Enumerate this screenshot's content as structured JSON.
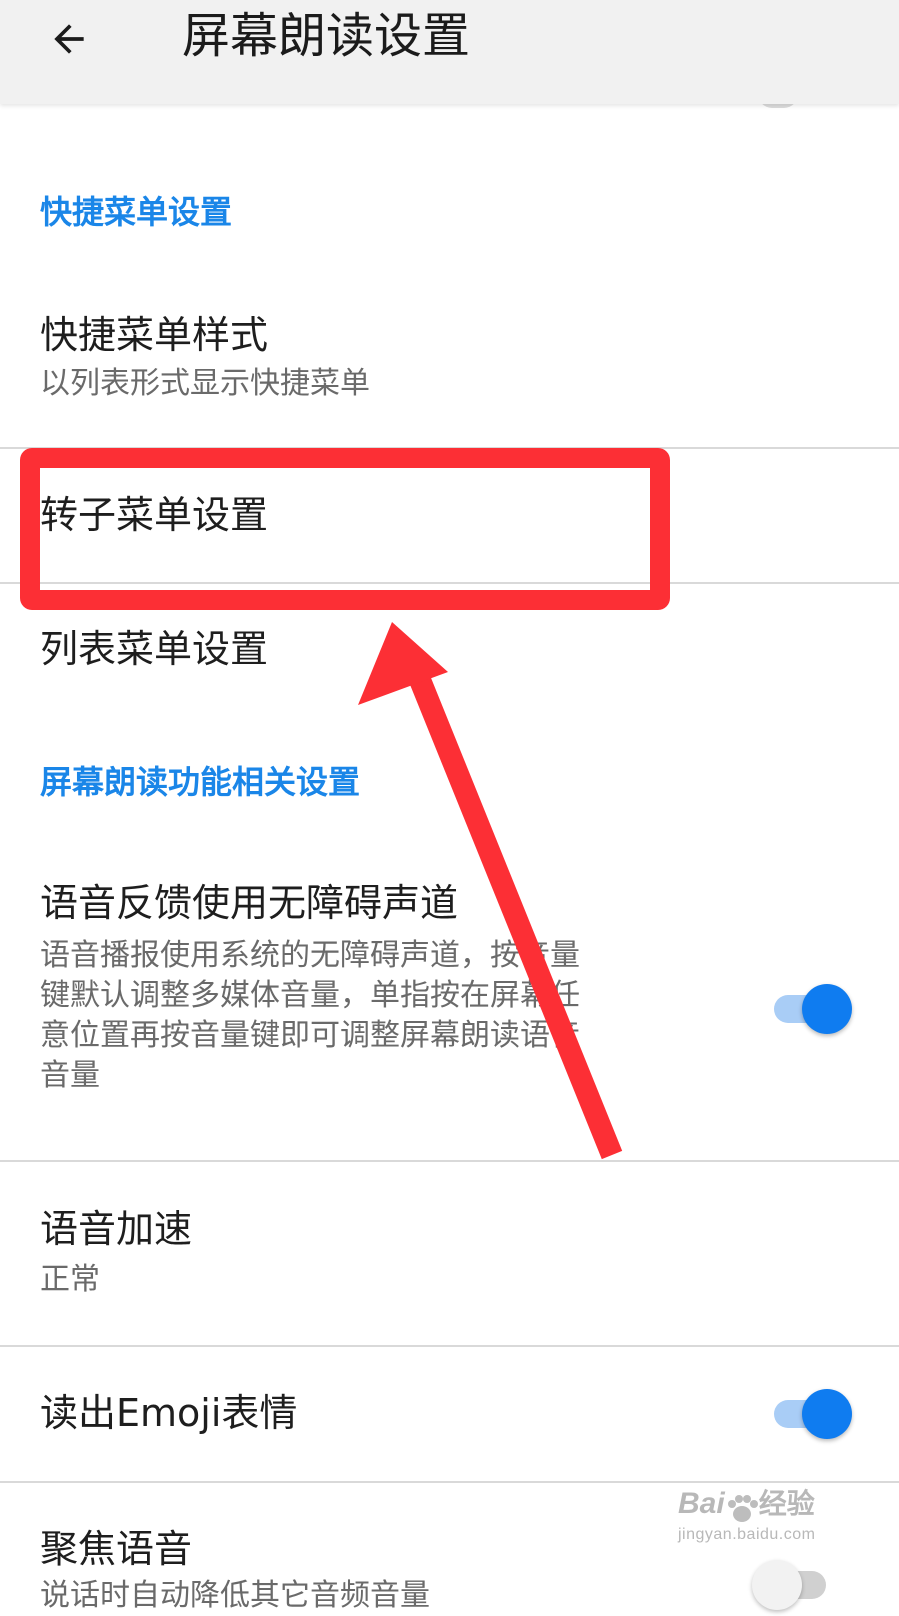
{
  "appbar": {
    "title": "屏幕朗读设置"
  },
  "sections": {
    "shortcut_menu": {
      "header": "快捷菜单设置",
      "style": {
        "title": "快捷菜单样式",
        "subtitle": "以列表形式显示快捷菜单"
      },
      "rotor": {
        "title": "转子菜单设置"
      },
      "list": {
        "title": "列表菜单设置"
      }
    },
    "function": {
      "header": "屏幕朗读功能相关设置",
      "a11y_channel": {
        "title": "语音反馈使用无障碍声道",
        "subtitle_lines": [
          "语音播报使用系统的无障碍声道，按音量",
          "键默认调整多媒体音量，单指按在屏幕任",
          "意位置再按音量键即可调整屏幕朗读语音",
          "音量"
        ],
        "enabled": true
      },
      "speed": {
        "title": "语音加速",
        "subtitle": "正常"
      },
      "emoji": {
        "title": "读出Emoji表情",
        "enabled": true
      },
      "focus": {
        "title": "聚焦语音",
        "subtitle": "说话时自动降低其它音频音量",
        "enabled": false
      }
    }
  },
  "annotation": {
    "color": "#fc2f35"
  },
  "watermark": {
    "brand": "Bai",
    "brand_suffix": "经验",
    "url": "jingyan.baidu.com"
  },
  "colors": {
    "accent": "#1a86e8",
    "toggle_on": "#0f7cf0",
    "toggle_track_on": "#a9cdf6",
    "annotation_red": "#fc2f35"
  },
  "icons": {
    "back": "arrow-left"
  }
}
